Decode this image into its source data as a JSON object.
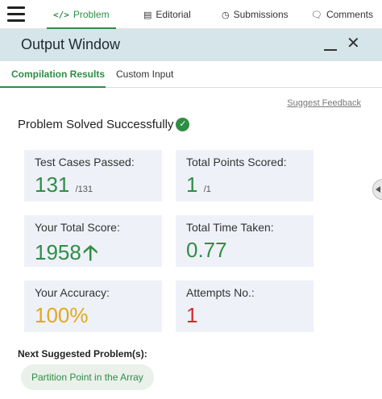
{
  "nav": {
    "tabs": [
      {
        "label": "Problem",
        "icon": "code-icon"
      },
      {
        "label": "Editorial",
        "icon": "document-icon"
      },
      {
        "label": "Submissions",
        "icon": "clock-icon"
      },
      {
        "label": "Comments",
        "icon": "comment-icon"
      }
    ]
  },
  "window": {
    "title": "Output Window",
    "tabs": [
      "Compilation Results",
      "Custom Input"
    ]
  },
  "feedback_link": "Suggest Feedback",
  "status": "Problem Solved Successfully",
  "stats": {
    "test_cases": {
      "label": "Test Cases Passed:",
      "value": "131",
      "total": "/131"
    },
    "points": {
      "label": "Total Points Scored:",
      "value": "1",
      "total": "/1"
    },
    "score": {
      "label": "Your Total Score:",
      "value": "1958"
    },
    "time": {
      "label": "Total Time Taken:",
      "value": "0.77"
    },
    "accuracy": {
      "label": "Your Accuracy:",
      "value": "100%"
    },
    "attempts": {
      "label": "Attempts No.:",
      "value": "1"
    }
  },
  "next": {
    "title": "Next Suggested Problem(s):",
    "items": [
      "Partition Point in the Array"
    ]
  },
  "colors": {
    "accent": "#2f8d46",
    "header_bg": "#d5e5ea",
    "card_bg": "#eef1f8",
    "accuracy": "#e3a91b",
    "attempts": "#d32b2b"
  }
}
